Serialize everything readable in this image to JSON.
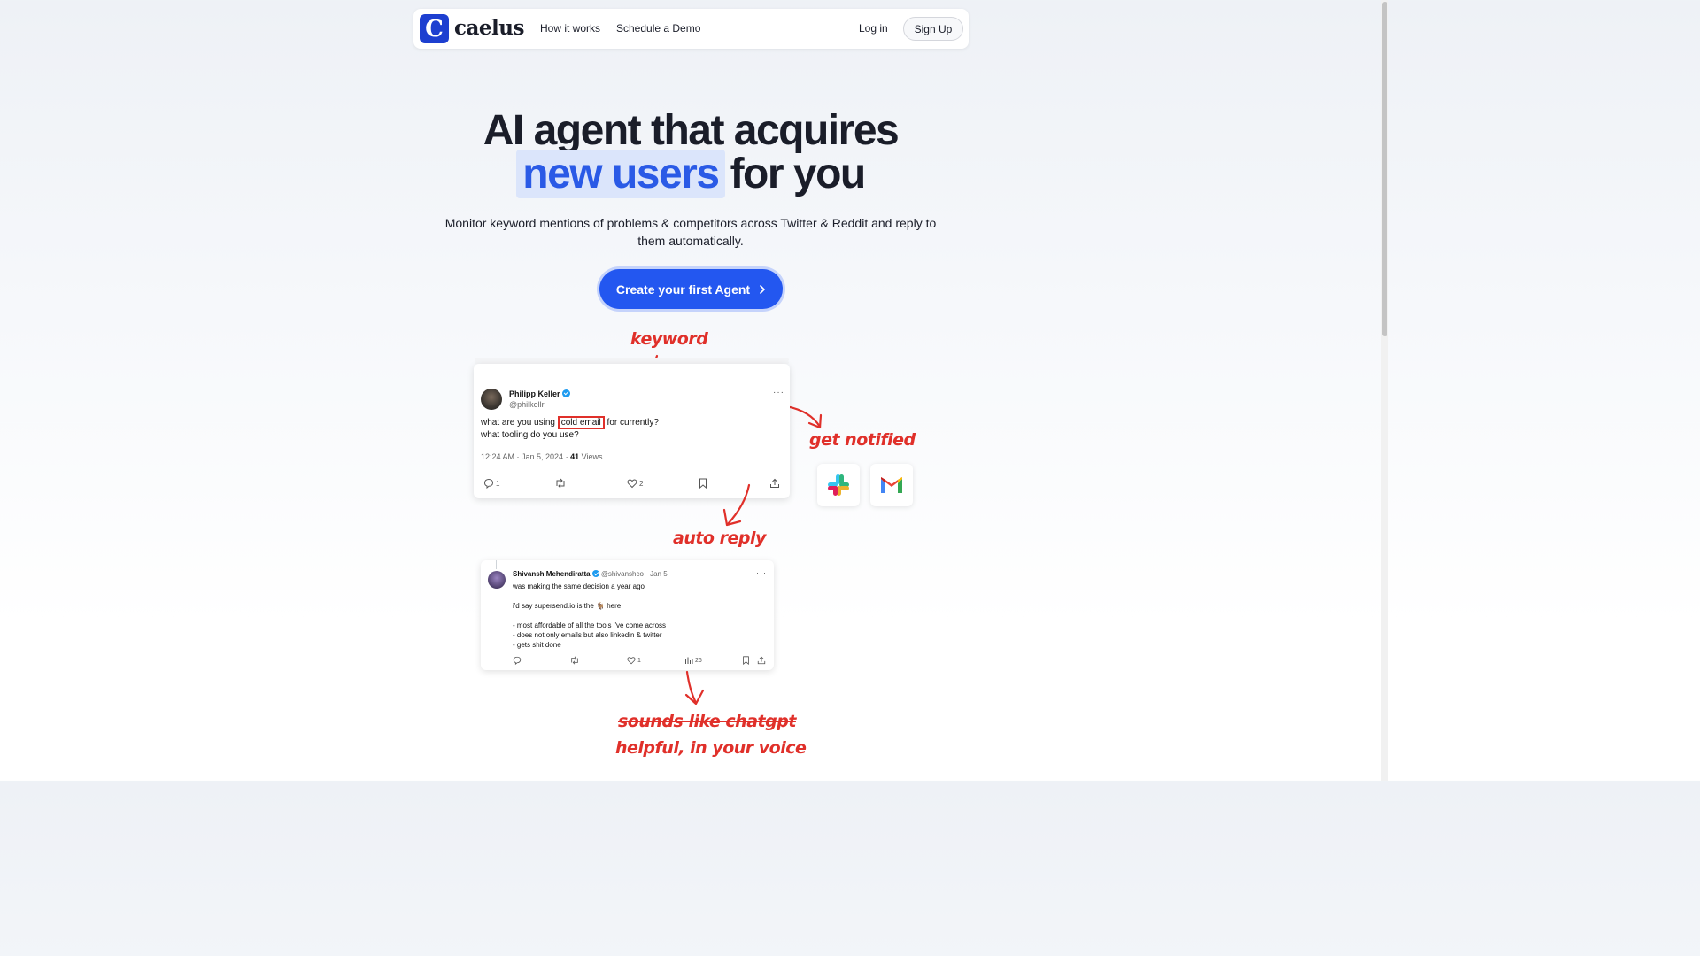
{
  "nav": {
    "logo_letter": "C",
    "logo_text": "caelus",
    "links": [
      "How it works",
      "Schedule a Demo"
    ],
    "login": "Log in",
    "signup": "Sign Up"
  },
  "hero": {
    "line1": "AI agent that acquires",
    "highlight": "new users",
    "line2_rest": "for you",
    "subtitle": "Monitor keyword mentions of problems & competitors across Twitter & Reddit and reply to them automatically.",
    "cta": "Create your first Agent"
  },
  "annotations": {
    "keyword": "keyword",
    "get_notified": "get notified",
    "auto_reply": "auto reply",
    "struck": "sounds like chatgpt",
    "voice": "helpful, in your voice"
  },
  "tweet1": {
    "name": "Philipp Keller",
    "handle": "@philkellr",
    "text_before": "what are you using",
    "keyword": "cold email",
    "text_after": "for currently?",
    "text_line2": "what tooling do you use?",
    "time": "12:24 AM · Jan 5, 2024 ·",
    "views_count": "41",
    "views_label": "Views",
    "replies": "1",
    "likes": "2"
  },
  "tweet2": {
    "name": "Shivansh Mehendiratta",
    "handle_date": "@shivanshco · Jan 5",
    "line1": "was making the same decision a year ago",
    "line2": "i'd say supersend.io is the 🐐 here",
    "bullet1": "- most affordable of all the tools i've come across",
    "bullet2": "- does not only emails but also linkedin & twitter",
    "bullet3": "- gets shit done",
    "likes": "1",
    "views": "26"
  },
  "colors": {
    "brand": "#1d3fd0",
    "cta": "#2357f0",
    "highlight_bg": "#dbe5fb",
    "highlight_text": "#2a5ae6",
    "annotation": "#e0302a"
  },
  "icons": [
    "slack-icon",
    "gmail-icon"
  ]
}
